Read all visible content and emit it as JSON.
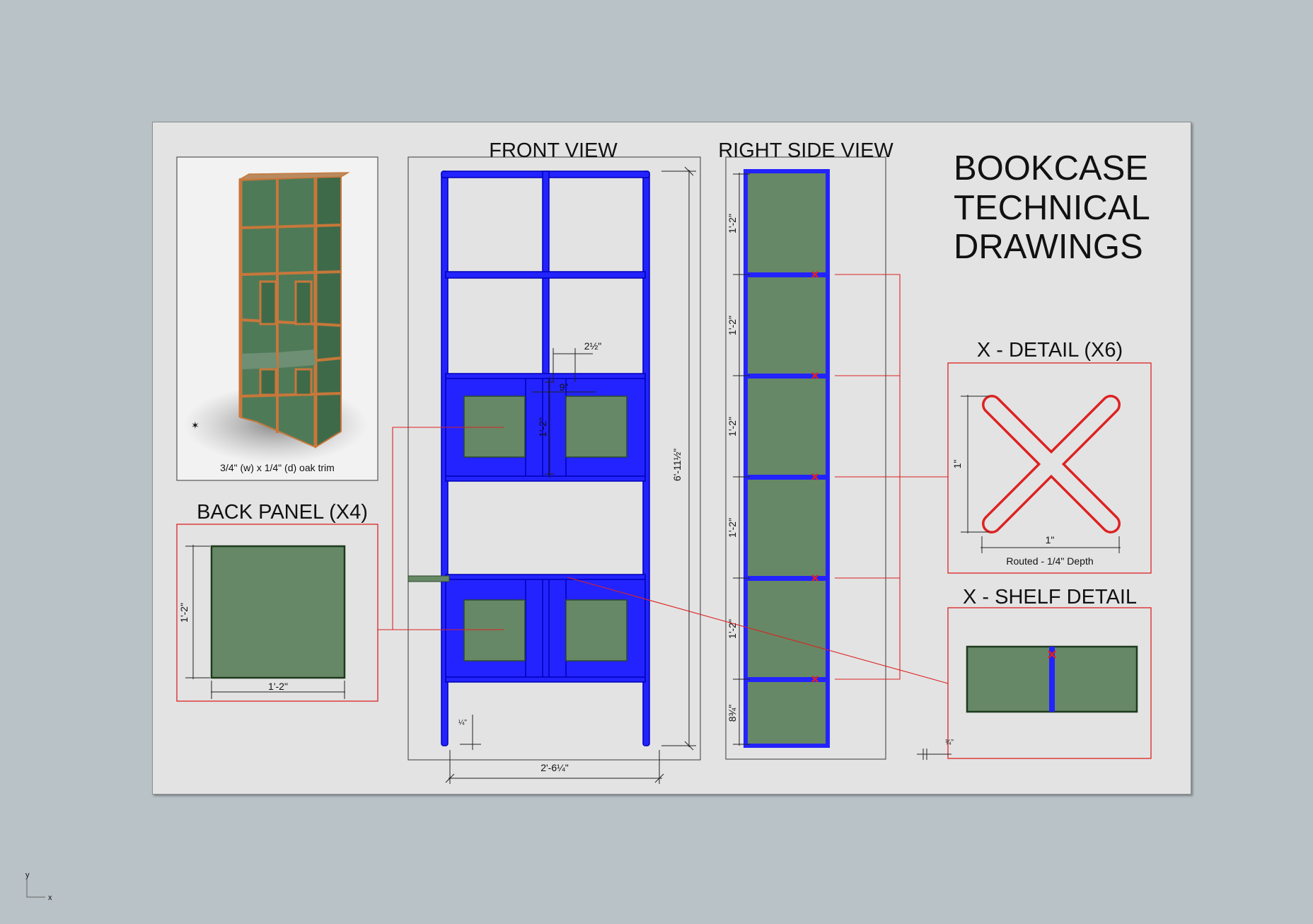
{
  "title": {
    "line1": "BOOKCASE",
    "line2": "TECHNICAL",
    "line3": "DRAWINGS"
  },
  "views": {
    "front": "FRONT VIEW",
    "right_side": "RIGHT SIDE VIEW",
    "back_panel": "BACK PANEL (X4)",
    "x_detail": "X - DETAIL (X6)",
    "x_shelf_detail": "X - SHELF DETAIL"
  },
  "render_caption": "3/4\" (w) x 1/4\" (d) oak trim",
  "dimensions": {
    "overall_height": "6'-11½\"",
    "overall_width": "2'-6¼\"",
    "door_gap": "2½\"",
    "door_width": "9\"",
    "door_height": "1'-2\"",
    "leg_width": "¼\"",
    "side_bay": "1'-2\"",
    "side_bottom": "8¾\"",
    "back_panel_h": "1'-2\"",
    "back_panel_w": "1'-2\"",
    "x_size_v": "1\"",
    "x_size_h": "1\"",
    "x_routed": "Routed - 1/4\" Depth",
    "shelf_thickness": "¾\""
  },
  "axes": {
    "x": "x",
    "y": "y"
  },
  "colors": {
    "background": "#b8c2c7",
    "sheet": "#e3e3e3",
    "frame_blue": "#2323ff",
    "panel_green": "#668866",
    "detail_red": "#dd2222"
  }
}
